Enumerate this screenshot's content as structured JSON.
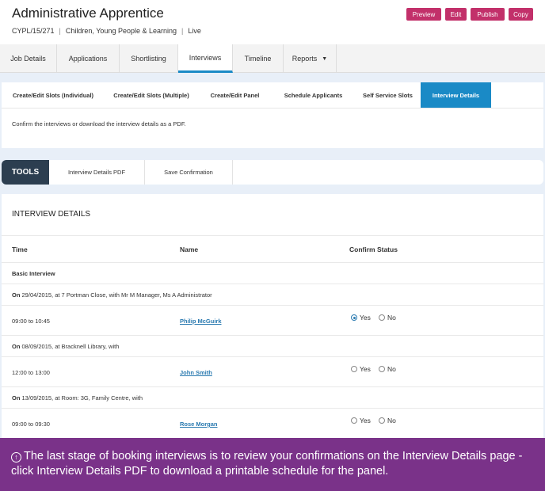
{
  "header": {
    "title": "Administrative Apprentice",
    "ref": "CYPL/15/271",
    "department": "Children, Young People & Learning",
    "status": "Live",
    "separator": "|",
    "buttons": [
      "Preview",
      "Edit",
      "Publish",
      "Copy"
    ],
    "button_color": "#c2306a"
  },
  "tabs": [
    {
      "label": "Job Details"
    },
    {
      "label": "Applications"
    },
    {
      "label": "Shortlisting"
    },
    {
      "label": "Interviews",
      "active": true
    },
    {
      "label": "Timeline"
    },
    {
      "label": "Reports",
      "icon": "caret-down-icon"
    }
  ],
  "subtabs": [
    {
      "label": "Create/Edit Slots (Individual)"
    },
    {
      "label": "Create/Edit Slots (Multiple)"
    },
    {
      "label": "Create/Edit Panel"
    },
    {
      "label": "Schedule Applicants"
    },
    {
      "label": "Self Service Slots"
    },
    {
      "label": "Interview Details",
      "active": true
    }
  ],
  "accent": "#1a8ac6",
  "description": "Confirm the interviews or download the interview details as a PDF.",
  "tools": {
    "label": "TOOLS",
    "items": [
      "Interview Details PDF",
      "Save Confirmation"
    ]
  },
  "details": {
    "title": "INTERVIEW DETAILS",
    "columns": [
      "Time",
      "Name",
      "Confirm Status"
    ],
    "group": "Basic Interview",
    "options": [
      "Yes",
      "No"
    ],
    "sessions": [
      {
        "prefix": "On",
        "info": "29/04/2015, at 7 Portman Close, with Mr M Manager, Ms A Administrator",
        "time": "09:00 to 10:45",
        "name": "Philip McGuirk",
        "confirm": "Yes"
      },
      {
        "prefix": "On",
        "info": "08/09/2015, at Bracknell Library, with",
        "time": "12:00 to 13:00",
        "name": "John Smith",
        "confirm": null
      },
      {
        "prefix": "On",
        "info": "13/09/2015, at Room: 3G, Family Centre, with",
        "time": "09:00 to 09:30",
        "name": "Rose Morgan",
        "confirm": null
      }
    ]
  },
  "banner": {
    "icon": "arrow-up-circle-icon",
    "text": "The last stage of booking interviews is to review your confirmations on the Interview Details page - click Interview Details PDF to download a printable schedule for the panel.",
    "color": "#7a3289"
  }
}
